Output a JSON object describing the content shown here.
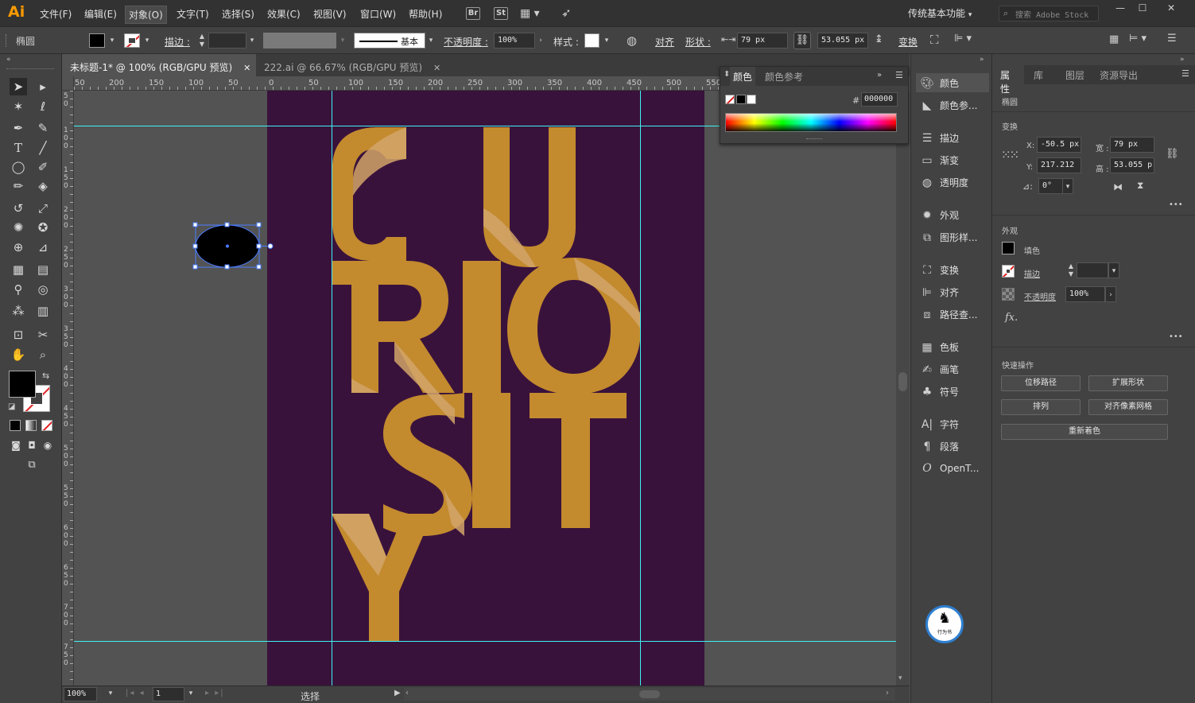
{
  "app": {
    "logo": "Ai"
  },
  "menu": {
    "items": [
      "文件(F)",
      "编辑(E)",
      "对象(O)",
      "文字(T)",
      "选择(S)",
      "效果(C)",
      "视图(V)",
      "窗口(W)",
      "帮助(H)"
    ],
    "bridge_label": "Br",
    "stock_label": "St",
    "workspace": "传统基本功能",
    "search_placeholder": "搜索 Adobe Stock",
    "window_buttons": {
      "minimize": "—",
      "maximize": "☐",
      "close": "✕"
    }
  },
  "control": {
    "object_type": "椭圆",
    "stroke_label": "描边 :",
    "brush_label": "基本",
    "opacity_label": "不透明度 :",
    "opacity_value": "100%",
    "style_label": "样式 :",
    "align_label": "对齐",
    "shape_label": "形状 :",
    "width_value": "79 px",
    "height_value": "53.055 px",
    "transform_label": "变换"
  },
  "tabs": [
    {
      "label": "未标题-1* @ 100% (RGB/GPU 预览)",
      "close": "✕"
    },
    {
      "label": "222.ai @ 66.67% (RGB/GPU 预览)",
      "close": "✕"
    }
  ],
  "rulers": {
    "h": [
      "50",
      "200",
      "150",
      "100",
      "50",
      "0",
      "50",
      "100",
      "150",
      "200",
      "250",
      "300",
      "350",
      "400",
      "450",
      "500",
      "550"
    ],
    "v": [
      "50",
      "100",
      "150",
      "200",
      "250",
      "300",
      "350",
      "400",
      "450",
      "500",
      "550",
      "600",
      "650",
      "700",
      "750"
    ]
  },
  "artwork": {
    "word_rows": [
      "CU",
      "RIO",
      "SIT",
      "Y"
    ],
    "letter_color": "#c38a2e",
    "fold_color": "#d2a468",
    "artboard_color": "#39123c"
  },
  "status": {
    "zoom": "100%",
    "page": "1",
    "tool": "选择"
  },
  "color_panel": {
    "tab_active": "颜色",
    "tab_inactive": "颜色参考",
    "hex_label": "#",
    "hex_value": "000000"
  },
  "icon_panel": {
    "items": [
      {
        "label": "颜色",
        "icon": "palette-icon"
      },
      {
        "label": "颜色参...",
        "icon": "color-guide-icon"
      },
      {
        "label": "描边",
        "icon": "stroke-icon"
      },
      {
        "label": "渐变",
        "icon": "gradient-icon"
      },
      {
        "label": "透明度",
        "icon": "transparency-icon"
      },
      {
        "label": "外观",
        "icon": "appearance-icon"
      },
      {
        "label": "图形样...",
        "icon": "graphic-styles-icon"
      },
      {
        "label": "变换",
        "icon": "transform-icon"
      },
      {
        "label": "对齐",
        "icon": "align-icon"
      },
      {
        "label": "路径查...",
        "icon": "pathfinder-icon"
      },
      {
        "label": "色板",
        "icon": "swatches-icon"
      },
      {
        "label": "画笔",
        "icon": "brushes-icon"
      },
      {
        "label": "符号",
        "icon": "symbols-icon"
      },
      {
        "label": "字符",
        "icon": "character-icon"
      },
      {
        "label": "段落",
        "icon": "paragraph-icon"
      },
      {
        "label": "OpenT...",
        "icon": "opentype-icon"
      }
    ]
  },
  "properties": {
    "tabs": [
      "属性",
      "库",
      "图层",
      "资源导出"
    ],
    "object_type": "椭圆",
    "transform_title": "变换",
    "x_label": "X:",
    "x_value": "-50.5 px",
    "y_label": "Y:",
    "y_value": "217.212",
    "w_label": "宽 :",
    "w_value": "79 px",
    "h_label": "高 :",
    "h_value": "53.055 p",
    "angle_value": "0°",
    "appearance_title": "外观",
    "fill_label": "填色",
    "stroke_label": "描边",
    "opacity_label": "不透明度",
    "opacity_value": "100%",
    "fx_label": "fx.",
    "quick_title": "快速操作",
    "buttons": [
      "位移路径",
      "扩展形状",
      "排列",
      "对齐像素网格",
      "重新着色"
    ],
    "more": "•••"
  },
  "watermark": {
    "text": "行为书"
  }
}
